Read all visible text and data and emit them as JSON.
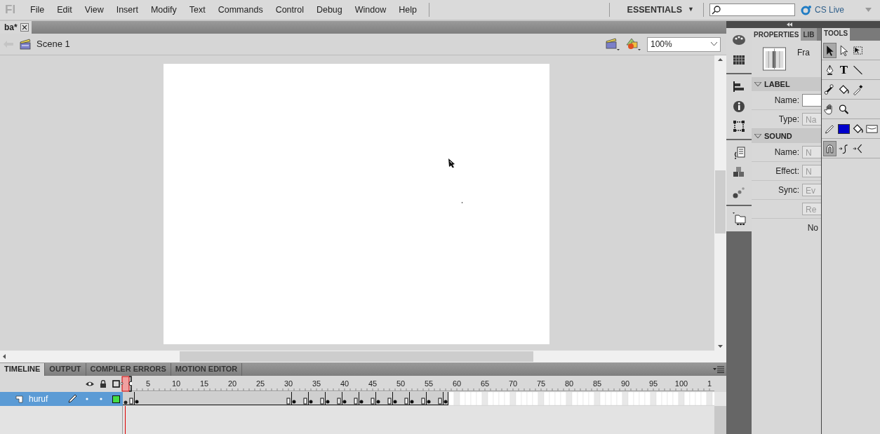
{
  "app_logo": "Fl",
  "menu": [
    "File",
    "Edit",
    "View",
    "Insert",
    "Modify",
    "Text",
    "Commands",
    "Control",
    "Debug",
    "Window",
    "Help"
  ],
  "workspace": {
    "label": "ESSENTIALS",
    "caret": "▼"
  },
  "cs_live": {
    "label": "CS Live"
  },
  "document_tabs": [
    {
      "label": "ba*",
      "selected": true
    }
  ],
  "edit_bar": {
    "scene": "Scene 1",
    "zoom": "100%"
  },
  "timeline_tabs": [
    {
      "label": "TIMELINE",
      "selected": true
    },
    {
      "label": "OUTPUT",
      "selected": false
    },
    {
      "label": "COMPILER ERRORS",
      "selected": false
    },
    {
      "label": "MOTION EDITOR",
      "selected": false
    }
  ],
  "frame_ruler": [
    "5",
    "10",
    "15",
    "20",
    "25",
    "30",
    "35",
    "40",
    "45",
    "50",
    "55",
    "60",
    "65",
    "70",
    "75",
    "80",
    "85",
    "90",
    "95",
    "100",
    "1"
  ],
  "layers": [
    {
      "name": "huruf",
      "selected": true
    }
  ],
  "properties": {
    "tabs": [
      {
        "label": "PROPERTIES",
        "selected": true
      },
      {
        "label": "LIB",
        "selected": false
      }
    ],
    "frame_label": "Fra",
    "sections": [
      {
        "title": "LABEL",
        "expanded": true,
        "rows": [
          {
            "kind": "input",
            "label": "Name:"
          },
          {
            "kind": "select",
            "label": "Type:",
            "value": "Na"
          }
        ]
      },
      {
        "title": "SOUND",
        "expanded": true,
        "rows": [
          {
            "kind": "select",
            "label": "Name:",
            "value": "N"
          },
          {
            "kind": "select",
            "label": "Effect:",
            "value": "N"
          },
          {
            "kind": "select",
            "label": "Sync:",
            "value": "Ev"
          },
          {
            "kind": "button",
            "value": "Re"
          }
        ]
      }
    ],
    "footer": "No"
  },
  "tools": {
    "title": "TOOLS",
    "rows": [
      [
        {
          "kind": "selection",
          "selected": true
        },
        {
          "kind": "subselection",
          "selected": false
        },
        {
          "kind": "free-transform",
          "selected": false
        }
      ],
      [
        {
          "kind": "pen",
          "selected": false
        },
        {
          "kind": "text",
          "glyph": "T",
          "selected": false
        },
        {
          "kind": "line",
          "selected": false
        }
      ],
      [
        {
          "kind": "bone",
          "selected": false
        },
        {
          "kind": "bucket",
          "selected": false
        },
        {
          "kind": "eyedropper",
          "selected": false
        }
      ],
      [
        {
          "kind": "hand",
          "selected": false
        },
        {
          "kind": "zoom",
          "selected": false
        }
      ],
      [
        {
          "kind": "pencil",
          "selected": false
        },
        {
          "kind": "swatch",
          "color": "#0000cc",
          "selected": false
        },
        {
          "kind": "bucket",
          "selected": false
        },
        {
          "kind": "swatch-outline",
          "selected": false
        }
      ],
      [
        {
          "kind": "magnet",
          "selected": true
        },
        {
          "kind": "smooth",
          "selected": false
        },
        {
          "kind": "straighten",
          "selected": false
        }
      ]
    ]
  }
}
